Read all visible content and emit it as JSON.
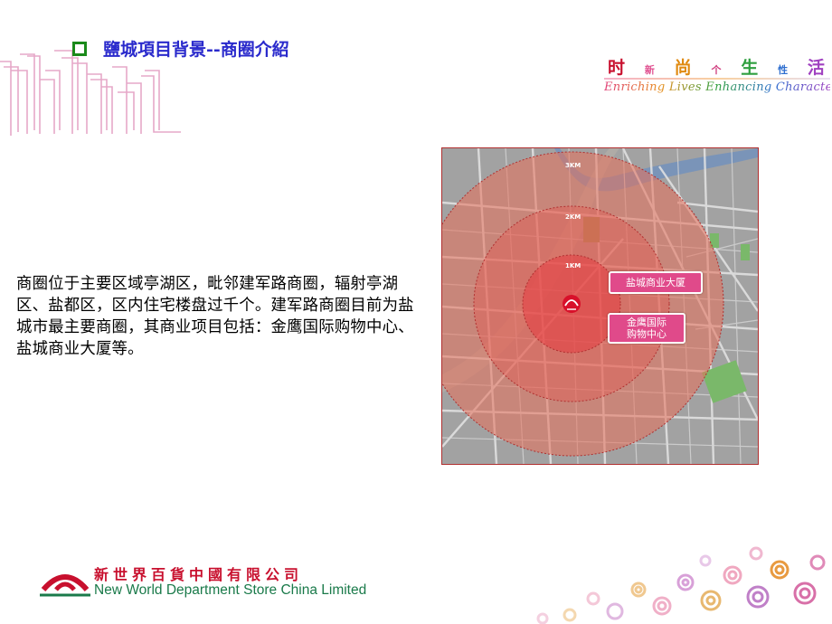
{
  "header": {
    "title": "鹽城項目背景--商圈介紹"
  },
  "slogan": {
    "cn": [
      "时",
      "新",
      "尚",
      "个",
      "生",
      "性",
      "活"
    ],
    "en": "Enriching Lives Enhancing Character",
    "colors": [
      "#c8102e",
      "#e05090",
      "#e08a10",
      "#d04080",
      "#30a040",
      "#3070d0",
      "#a040c0"
    ]
  },
  "body": {
    "text": "商圈位于主要区域亭湖区，毗邻建军路商圈，辐射亭湖区、盐都区，区内住宅楼盘过千个。建军路商圈目前为盐城市最主要商圈，其商业项目包括：金鹰国际购物中心、盐城商业大厦等。"
  },
  "map": {
    "rings": [
      "3KM",
      "2KM",
      "1KM"
    ],
    "labels": {
      "yancheng_building": "盐城商业大厦",
      "golden_eagle": "金鹰国际\n购物中心"
    }
  },
  "footer": {
    "company_cn": "新世界百貨中國有限公司",
    "company_en": "New World Department Store China Limited"
  },
  "colors": {
    "title": "#2a2acc",
    "bullet": "#1a8a1a",
    "label_bg": "#e04a8a",
    "brand_red": "#c8102e",
    "brand_green": "#1a7a4a"
  }
}
